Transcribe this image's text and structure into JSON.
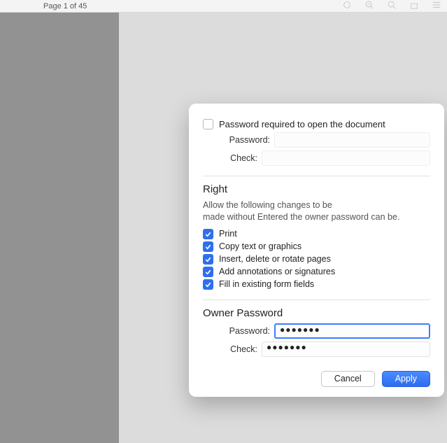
{
  "topbar": {
    "page_indicator": "Page 1 of 45"
  },
  "dialog": {
    "open_pw": {
      "checkbox_label": "Password required to open the document",
      "password_label": "Password:",
      "check_label": "Check:"
    },
    "rights": {
      "title": "Right",
      "desc_line1": "Allow the following changes to be",
      "desc_line2": "made without Entered the owner password can be.",
      "perms": [
        {
          "label": "Print",
          "checked": true
        },
        {
          "label": "Copy text or graphics",
          "checked": true
        },
        {
          "label": "Insert, delete or rotate pages",
          "checked": true
        },
        {
          "label": "Add annotations or signatures",
          "checked": true
        },
        {
          "label": "Fill in existing form fields",
          "checked": true
        }
      ]
    },
    "owner_pw": {
      "title": "Owner Password",
      "password_label": "Password:",
      "check_label": "Check:",
      "password_value": "●●●●●●●",
      "check_value": "●●●●●●●"
    },
    "buttons": {
      "cancel": "Cancel",
      "apply": "Apply"
    }
  }
}
